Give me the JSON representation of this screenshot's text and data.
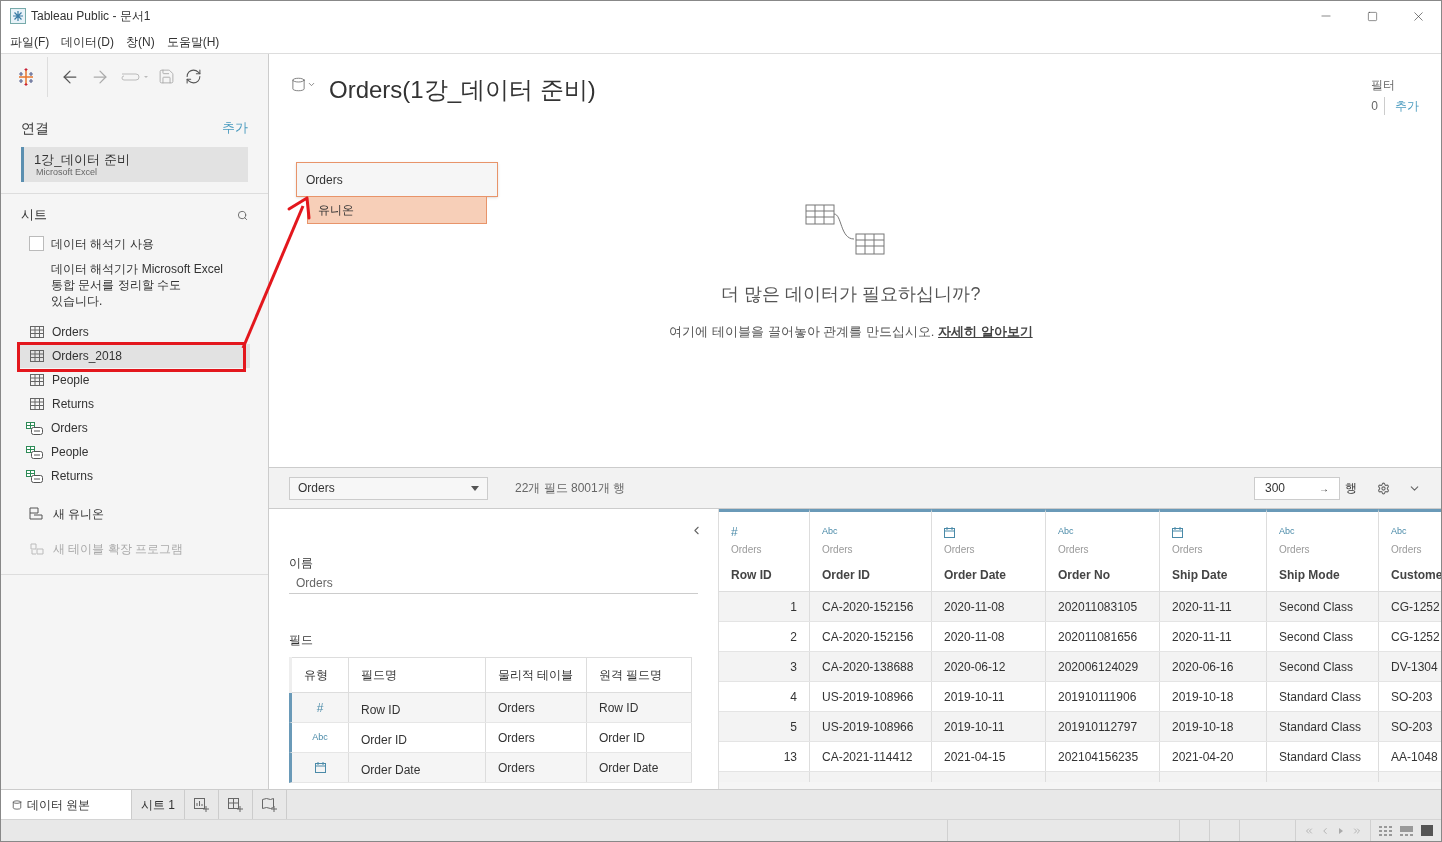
{
  "window": {
    "title": "Tableau Public - 문서1"
  },
  "menu": [
    "파일(F)",
    "데이터(D)",
    "창(N)",
    "도움말(H)"
  ],
  "connections": {
    "title": "연결",
    "add": "추가",
    "items": [
      {
        "name": "1강_데이터 준비",
        "type": "Microsoft Excel",
        "selected": true
      }
    ]
  },
  "sheets": {
    "title": "시트",
    "interpreter": {
      "label": "데이터 해석기 사용",
      "checked": false,
      "description": "데이터 해석기가 Microsoft Excel 통합 문서를 정리할 수도 있습니다."
    },
    "items": [
      {
        "name": "Orders",
        "kind": "table",
        "selected": false
      },
      {
        "name": "Orders_2018",
        "kind": "table",
        "selected": true
      },
      {
        "name": "People",
        "kind": "table",
        "selected": false
      },
      {
        "name": "Returns",
        "kind": "table",
        "selected": false
      },
      {
        "name": "Orders",
        "kind": "range",
        "selected": false
      },
      {
        "name": "People",
        "kind": "range",
        "selected": false
      },
      {
        "name": "Returns",
        "kind": "range",
        "selected": false
      }
    ],
    "new_union": "새 유니온",
    "new_extension": {
      "label": "새 테이블 확장 프로그램",
      "disabled": true
    }
  },
  "canvas": {
    "title": "Orders(1강_데이터 준비)",
    "filter": {
      "label": "필터",
      "count": "0",
      "add": "추가"
    },
    "table": {
      "name": "Orders",
      "union": "유니온"
    },
    "empty": {
      "heading": "더 많은 데이터가 필요하십니까?",
      "text": "여기에 테이블을 끌어놓아 관계를 만드십시오.",
      "link": "자세히 알아보기"
    }
  },
  "databar": {
    "table_select": "Orders",
    "summary": "22개 필드 8001개 행",
    "rows_input": "300",
    "rows_label": "행",
    "rows_apply": "→"
  },
  "metadata": {
    "name_label": "이름",
    "name_value": "Orders",
    "fields_label": "필드",
    "columns": [
      "유형",
      "필드명",
      "물리적 테이블",
      "원격 필드명"
    ],
    "rows": [
      {
        "kind": "number",
        "type_text": "#",
        "name": "Row ID",
        "table": "Orders",
        "remote": "Row ID"
      },
      {
        "kind": "string",
        "type_text": "Abc",
        "name": "Order ID",
        "table": "Orders",
        "remote": "Order ID"
      },
      {
        "kind": "date",
        "name": "Order Date",
        "table": "Orders",
        "remote": "Order Date"
      }
    ]
  },
  "grid": {
    "columns": [
      {
        "kind": "number",
        "type_text": "#",
        "source": "Orders",
        "name": "Row ID"
      },
      {
        "kind": "string",
        "type_text": "Abc",
        "source": "Orders",
        "name": "Order ID"
      },
      {
        "kind": "date",
        "source": "Orders",
        "name": "Order Date"
      },
      {
        "kind": "string",
        "type_text": "Abc",
        "source": "Orders",
        "name": "Order No"
      },
      {
        "kind": "date",
        "source": "Orders",
        "name": "Ship Date"
      },
      {
        "kind": "string",
        "type_text": "Abc",
        "source": "Orders",
        "name": "Ship Mode"
      },
      {
        "kind": "string",
        "type_text": "Abc",
        "source": "Orders",
        "name": "Custome"
      }
    ],
    "rows": [
      [
        "1",
        "CA-2020-152156",
        "2020-11-08",
        "202011083105",
        "2020-11-11",
        "Second Class",
        "CG-1252"
      ],
      [
        "2",
        "CA-2020-152156",
        "2020-11-08",
        "202011081656",
        "2020-11-11",
        "Second Class",
        "CG-1252"
      ],
      [
        "3",
        "CA-2020-138688",
        "2020-06-12",
        "202006124029",
        "2020-06-16",
        "Second Class",
        "DV-1304"
      ],
      [
        "4",
        "US-2019-108966",
        "2019-10-11",
        "201910111906",
        "2019-10-18",
        "Standard Class",
        "SO-203"
      ],
      [
        "5",
        "US-2019-108966",
        "2019-10-11",
        "201910112797",
        "2019-10-18",
        "Standard Class",
        "SO-203"
      ],
      [
        "13",
        "CA-2021-114412",
        "2021-04-15",
        "202104156235",
        "2021-04-20",
        "Standard Class",
        "AA-1048"
      ]
    ]
  },
  "tabs": [
    {
      "label": "데이터 원본",
      "kind": "source",
      "selected": true
    },
    {
      "label": "시트 1",
      "kind": "sheet",
      "selected": false
    }
  ]
}
